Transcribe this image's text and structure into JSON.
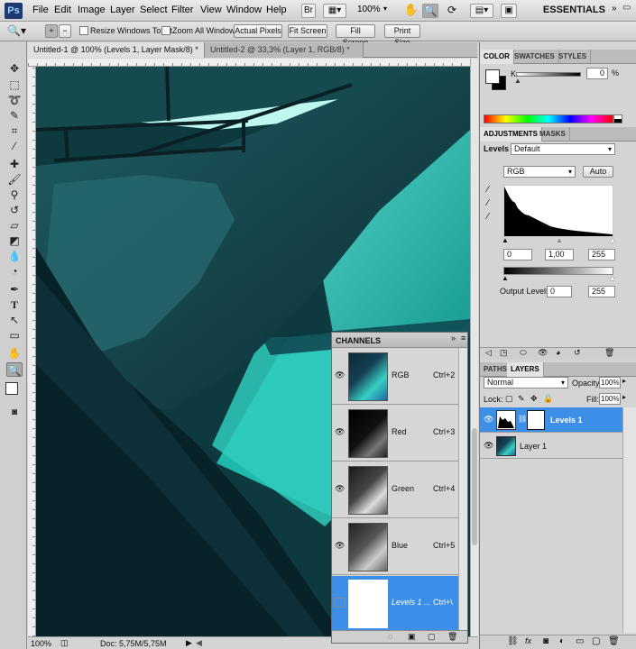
{
  "menubar": {
    "logo": "Ps",
    "items": [
      "File",
      "Edit",
      "Image",
      "Layer",
      "Select",
      "Filter",
      "View",
      "Window",
      "Help"
    ],
    "zoom": "100%",
    "workspace": "ESSENTIALS"
  },
  "optionsbar": {
    "resize_windows": "Resize Windows To Fit",
    "zoom_all_windows": "Zoom All Windows",
    "actual_pixels": "Actual Pixels",
    "fit_screen": "Fit Screen",
    "fill_screen": "Fill Screen",
    "print_size": "Print Size"
  },
  "doc_tabs": [
    {
      "label": "Untitled-1 @ 100% (Levels 1, Layer Mask/8) *"
    },
    {
      "label": "Untitled-2 @ 33,3% (Layer 1, RGB/8) *"
    }
  ],
  "statusbar": {
    "zoom": "100%",
    "doc_info": "Doc: 5,75M/5,75M"
  },
  "channels": {
    "title": "CHANNELS",
    "rows": [
      {
        "name": "RGB",
        "shortcut": "Ctrl+2"
      },
      {
        "name": "Red",
        "shortcut": "Ctrl+3"
      },
      {
        "name": "Green",
        "shortcut": "Ctrl+4"
      },
      {
        "name": "Blue",
        "shortcut": "Ctrl+5"
      },
      {
        "name": "Levels 1 ...",
        "shortcut": "Ctrl+\\"
      }
    ]
  },
  "color_panel": {
    "tabs": [
      "COLOR",
      "SWATCHES",
      "STYLES"
    ],
    "k_label": "K",
    "k_value": "0",
    "k_unit": "%"
  },
  "adjustments": {
    "tabs": [
      "ADJUSTMENTS",
      "MASKS"
    ],
    "levels_label": "Levels",
    "preset": "Default",
    "channel": "RGB",
    "auto": "Auto",
    "input_black": "0",
    "input_gamma": "1,00",
    "input_white": "255",
    "output_label": "Output Levels:",
    "output_black": "0",
    "output_white": "255"
  },
  "layers": {
    "tabs": [
      "PATHS",
      "LAYERS"
    ],
    "blend_mode": "Normal",
    "opacity_label": "Opacity:",
    "opacity": "100%",
    "lock_label": "Lock:",
    "fill_label": "Fill:",
    "fill": "100%",
    "items": [
      {
        "name": "Levels 1"
      },
      {
        "name": "Layer 1"
      }
    ]
  }
}
